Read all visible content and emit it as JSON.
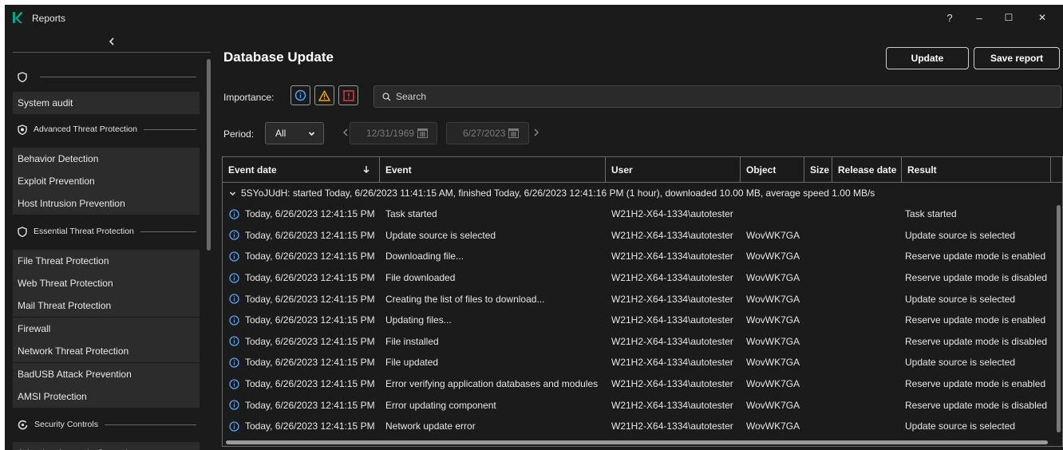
{
  "window": {
    "title": "Reports",
    "controls": {
      "help": "?",
      "minimize": "–",
      "maximize": "☐",
      "close": "✕"
    }
  },
  "sidebar": {
    "collapse_icon": "chevron-left-icon",
    "top_section_icon": "shield-icon",
    "items": [
      {
        "id": "system-audit",
        "label": "System audit"
      },
      {
        "id": "adv-threat-section",
        "label": "Advanced Threat Protection",
        "section": true
      },
      {
        "id": "behavior-detection",
        "label": "Behavior Detection"
      },
      {
        "id": "exploit-prevention",
        "label": "Exploit Prevention"
      },
      {
        "id": "host-intrusion-prevention",
        "label": "Host Intrusion Prevention"
      },
      {
        "id": "essential-threat-section",
        "label": "Essential Threat Protection",
        "section": true
      },
      {
        "id": "file-threat-protection",
        "label": "File Threat Protection"
      },
      {
        "id": "web-threat-protection",
        "label": "Web Threat Protection"
      },
      {
        "id": "mail-threat-protection",
        "label": "Mail Threat Protection"
      },
      {
        "id": "firewall",
        "label": "Firewall"
      },
      {
        "id": "network-threat-protection",
        "label": "Network Threat Protection"
      },
      {
        "id": "badusb-attack-prevention",
        "label": "BadUSB Attack Prevention"
      },
      {
        "id": "amsi-protection",
        "label": "AMSI Protection"
      },
      {
        "id": "security-controls-section",
        "label": "Security Controls",
        "section": true
      },
      {
        "id": "adaptive-anomaly-control",
        "label": "Adaptive Anomaly Control"
      }
    ]
  },
  "main": {
    "title": "Database Update",
    "buttons": {
      "update": "Update",
      "save_report": "Save report"
    },
    "importance_label": "Importance:",
    "search_placeholder": "Search",
    "period_label": "Period:",
    "period_value": "All",
    "date_from": "12/31/1969",
    "date_to": "6/27/2023"
  },
  "table": {
    "columns": [
      "Event date",
      "Event",
      "User",
      "Object",
      "Size",
      "Release date",
      "Result"
    ],
    "group": "5SYoJUdH: started Today, 6/26/2023 11:41:15 AM, finished Today, 6/26/2023 12:41:16 PM (1 hour), downloaded 10.00 MB, average speed 1.00 MB/s",
    "rows": [
      {
        "date": "Today, 6/26/2023 12:41:15 PM",
        "event": "Task started",
        "user": "W21H2-X64-1334\\autotester",
        "object": "",
        "result": "Task started"
      },
      {
        "date": "Today, 6/26/2023 12:41:15 PM",
        "event": "Update source is selected",
        "user": "W21H2-X64-1334\\autotester",
        "object": "WovWK7GA",
        "result": "Update source is selected"
      },
      {
        "date": "Today, 6/26/2023 12:41:15 PM",
        "event": "Downloading file...",
        "user": "W21H2-X64-1334\\autotester",
        "object": "WovWK7GA",
        "result": "Reserve update mode is enabled"
      },
      {
        "date": "Today, 6/26/2023 12:41:15 PM",
        "event": "File downloaded",
        "user": "W21H2-X64-1334\\autotester",
        "object": "WovWK7GA",
        "result": "Reserve update mode is disabled"
      },
      {
        "date": "Today, 6/26/2023 12:41:15 PM",
        "event": "Creating the list of files to download...",
        "user": "W21H2-X64-1334\\autotester",
        "object": "WovWK7GA",
        "result": "Update source is selected"
      },
      {
        "date": "Today, 6/26/2023 12:41:15 PM",
        "event": "Updating files...",
        "user": "W21H2-X64-1334\\autotester",
        "object": "WovWK7GA",
        "result": "Reserve update mode is enabled"
      },
      {
        "date": "Today, 6/26/2023 12:41:15 PM",
        "event": "File installed",
        "user": "W21H2-X64-1334\\autotester",
        "object": "WovWK7GA",
        "result": "Reserve update mode is disabled"
      },
      {
        "date": "Today, 6/26/2023 12:41:15 PM",
        "event": "File updated",
        "user": "W21H2-X64-1334\\autotester",
        "object": "WovWK7GA",
        "result": "Update source is selected"
      },
      {
        "date": "Today, 6/26/2023 12:41:15 PM",
        "event": "Error verifying application databases and modules",
        "user": "W21H2-X64-1334\\autotester",
        "object": "WovWK7GA",
        "result": "Reserve update mode is enabled"
      },
      {
        "date": "Today, 6/26/2023 12:41:15 PM",
        "event": "Error updating component",
        "user": "W21H2-X64-1334\\autotester",
        "object": "WovWK7GA",
        "result": "Reserve update mode is disabled"
      },
      {
        "date": "Today, 6/26/2023 12:41:15 PM",
        "event": "Network update error",
        "user": "W21H2-X64-1334\\autotester",
        "object": "WovWK7GA",
        "result": "Update source is selected"
      }
    ]
  },
  "colors": {
    "brand": "#00a88e",
    "info": "#4da3ff",
    "warning": "#f0a500",
    "error": "#e03b3b"
  }
}
